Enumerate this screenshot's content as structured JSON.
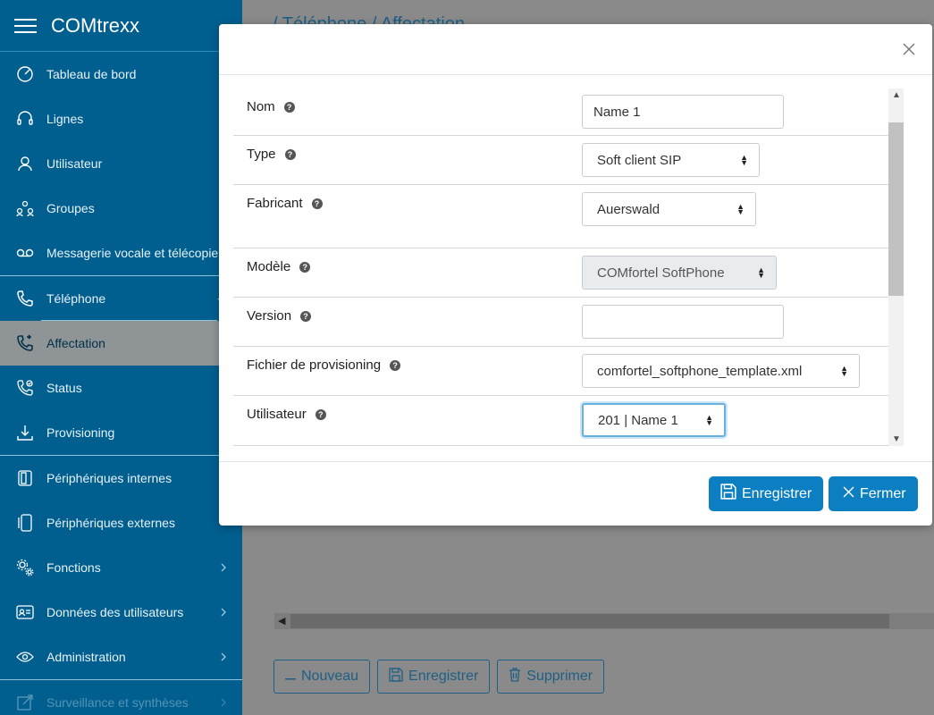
{
  "app": {
    "brand": "COMtrexx"
  },
  "sidebar": {
    "items": [
      {
        "label": "Tableau de bord"
      },
      {
        "label": "Lignes"
      },
      {
        "label": "Utilisateur"
      },
      {
        "label": "Groupes"
      },
      {
        "label": "Messagerie vocale et télécopie"
      },
      {
        "label": "Téléphone"
      },
      {
        "label": "Affectation"
      },
      {
        "label": "Status"
      },
      {
        "label": "Provisioning"
      },
      {
        "label": "Périphériques internes"
      },
      {
        "label": "Périphériques externes"
      },
      {
        "label": "Fonctions"
      },
      {
        "label": "Données des utilisateurs"
      },
      {
        "label": "Administration"
      },
      {
        "label": "Surveillance et synthèses"
      }
    ]
  },
  "main": {
    "breadcrumb": "/ Téléphone / Affectation",
    "buttons": {
      "new": "Nouveau",
      "save": "Enregistrer",
      "delete": "Supprimer"
    }
  },
  "modal": {
    "fields": {
      "nom": {
        "label": "Nom",
        "value": "Name 1"
      },
      "type": {
        "label": "Type",
        "value": "Soft client SIP"
      },
      "fabricant": {
        "label": "Fabricant",
        "value": "Auerswald"
      },
      "modele": {
        "label": "Modèle",
        "value": "COMfortel SoftPhone"
      },
      "version": {
        "label": "Version",
        "value": ""
      },
      "fichier": {
        "label": "Fichier de provisioning",
        "value": "comfortel_softphone_template.xml"
      },
      "utilisateur": {
        "label": "Utilisateur",
        "value": "201 | Name 1"
      }
    },
    "footer": {
      "save": "Enregistrer",
      "close": "Fermer"
    }
  },
  "colors": {
    "sidebar": "#005f8f",
    "accent": "#0b7fc2",
    "active_item": "#8f9597"
  }
}
